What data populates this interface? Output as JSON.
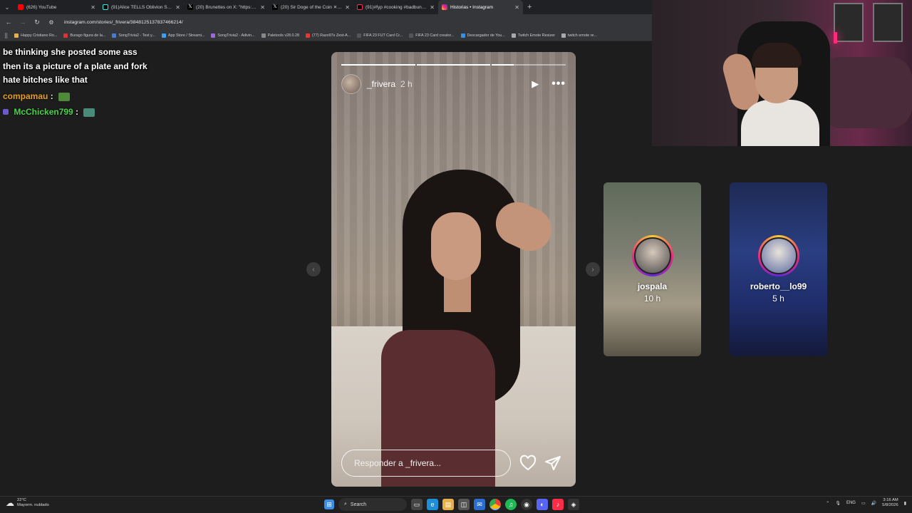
{
  "browser": {
    "tabs": [
      {
        "label": "(626) YouTube",
        "color": "#ff0000"
      },
      {
        "label": "(91)Alice TELLS Oblivion She W...",
        "color": "#111111"
      },
      {
        "label": "(20) Brunettes on X: \"https://t...",
        "color": "#222222"
      },
      {
        "label": "(20) Sir Doge of the Coin ✕ on...",
        "color": "#222222"
      },
      {
        "label": "(91)#fyp #cooking #badbunny...",
        "color": "#111111"
      },
      {
        "label": "Historias • Instagram",
        "color": "#d62976"
      }
    ],
    "url": "instagram.com/stories/_frivera/3848125137837466214/",
    "bookmarks": [
      "Happy Cristiano Ro...",
      "Burago figura de la...",
      "SongTrivia2 - Test y...",
      "App Store / Streami...",
      "SongTrivia2 - Adivin...",
      "Paletools v28.0.28",
      "(77) Razo97s Zest-A...",
      "FIFA 23 FUT Card Cr...",
      "FIFA 23 Card creator...",
      "Descargador de You...",
      "Twitch Emote Resizer",
      "twitch emote re..."
    ]
  },
  "chat": {
    "lines": [
      "be thinking she posted some ass",
      "then its a picture of a plate and fork",
      "hate bitches like that"
    ],
    "messages": [
      {
        "user": "compamau",
        "sep": ":",
        "color": "#e8a01c"
      },
      {
        "user": "McChicken799",
        "sep": ":",
        "color": "#4ad34a"
      }
    ]
  },
  "story": {
    "username": "_frivera",
    "time": "2 h",
    "progress": [
      1,
      1,
      0.3
    ],
    "reply_placeholder": "Responder a _frivera..."
  },
  "next_stories": [
    {
      "username": "jospala",
      "time": "10 h"
    },
    {
      "username": "roberto__lo99",
      "time": "5 h"
    }
  ],
  "taskbar": {
    "temperature": "22°C",
    "weather": "Mayorm. nublado",
    "search": "Search",
    "lang": "ENG",
    "time": "3:16 AM",
    "date": "5/8/2026"
  }
}
